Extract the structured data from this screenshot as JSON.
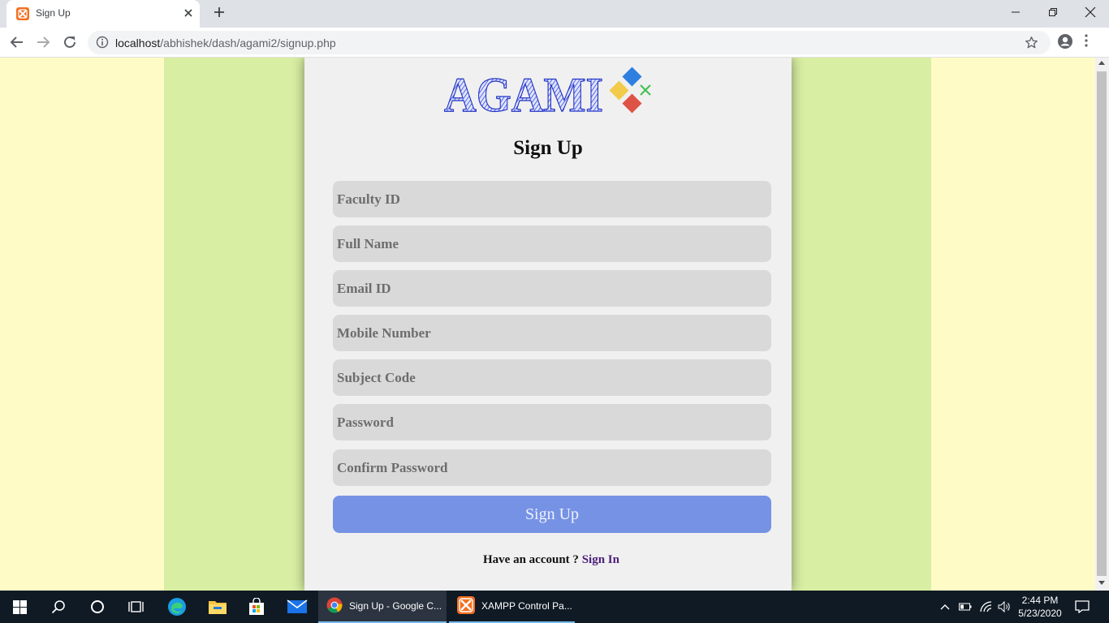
{
  "browser": {
    "tab_title": "Sign Up",
    "url_host": "localhost",
    "url_path": "/abhishek/dash/agami2/signup.php"
  },
  "page": {
    "logo_text": "AGAMI",
    "title": "Sign Up",
    "fields": {
      "faculty_id": "Faculty ID",
      "full_name": "Full Name",
      "email": "Email ID",
      "mobile": "Mobile Number",
      "subject_code": "Subject Code",
      "password": "Password",
      "confirm_password": "Confirm Password"
    },
    "submit_label": "Sign Up",
    "account_prompt": "Have an account ? ",
    "signin_link": "Sign In"
  },
  "taskbar": {
    "tasks": [
      {
        "label": "Sign Up - Google C..."
      },
      {
        "label": "XAMPP Control Pa..."
      }
    ],
    "time": "2:44 PM",
    "date": "5/23/2020"
  },
  "colors": {
    "page_bg": "#fefbc6",
    "band_bg": "#d8eea2",
    "card_bg": "#f0f0f0",
    "button_bg": "#7692e4",
    "link": "#4b1f7a"
  },
  "icons": [
    "xampp-favicon-icon",
    "close-icon",
    "plus-icon",
    "minimize-icon",
    "restore-icon",
    "back-arrow-icon",
    "forward-arrow-icon",
    "reload-icon",
    "info-icon",
    "star-icon",
    "account-icon",
    "more-vert-icon",
    "windows-start-icon",
    "search-icon",
    "cortana-icon",
    "task-view-icon",
    "edge-icon",
    "file-explorer-icon",
    "store-icon",
    "mail-icon",
    "chrome-icon",
    "xampp-icon",
    "chevron-up-icon",
    "battery-icon",
    "wifi-icon",
    "volume-icon",
    "notification-icon"
  ]
}
